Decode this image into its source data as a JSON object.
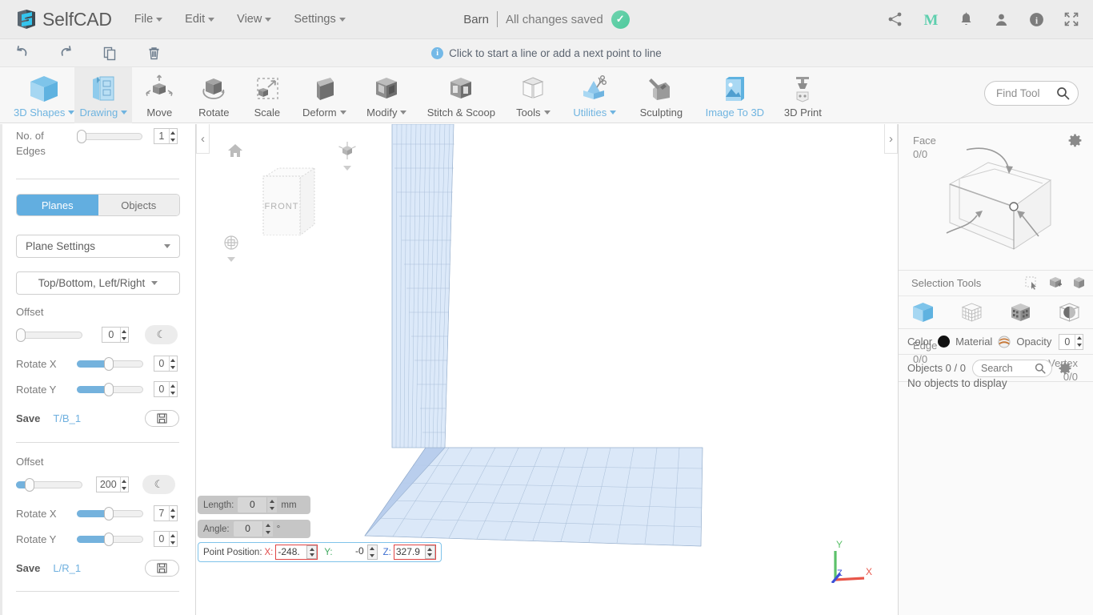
{
  "app": {
    "brand": "SelfCAD",
    "menus": [
      {
        "label": "File",
        "caret": true
      },
      {
        "label": "Edit",
        "caret": true
      },
      {
        "label": "View",
        "caret": true
      },
      {
        "label": "Settings",
        "caret": true
      }
    ],
    "document": {
      "name": "Barn",
      "status": "All changes saved",
      "status_icon": "check-circle-icon"
    },
    "top_icons": [
      "share-icon",
      "m-logo-icon",
      "bell-icon",
      "user-icon",
      "info-icon",
      "fullscreen-icon"
    ]
  },
  "actionbar": {
    "buttons": [
      "undo-icon",
      "redo-icon",
      "copy-icon",
      "trash-icon"
    ],
    "hint": "Click to start a line or add a next point to line"
  },
  "ribbon": {
    "tools": [
      {
        "label": "3D Shapes",
        "caret": true,
        "blue": true,
        "icon": "cube-blue-icon",
        "active": false
      },
      {
        "label": "Drawing",
        "caret": true,
        "blue": true,
        "icon": "drawing-icon",
        "active": true
      },
      {
        "label": "Move",
        "caret": false,
        "blue": false,
        "icon": "move-icon",
        "active": false
      },
      {
        "label": "Rotate",
        "caret": false,
        "blue": false,
        "icon": "rotate-icon",
        "active": false
      },
      {
        "label": "Scale",
        "caret": false,
        "blue": false,
        "icon": "scale-icon",
        "active": false
      },
      {
        "label": "Deform",
        "caret": true,
        "blue": false,
        "icon": "deform-icon",
        "active": false
      },
      {
        "label": "Modify",
        "caret": true,
        "blue": false,
        "icon": "modify-icon",
        "active": false
      },
      {
        "label": "Stitch & Scoop",
        "caret": false,
        "blue": false,
        "icon": "stitch-scoop-icon",
        "active": false
      },
      {
        "label": "Tools",
        "caret": true,
        "blue": false,
        "icon": "tools-icon",
        "active": false
      },
      {
        "label": "Utilities",
        "caret": true,
        "blue": true,
        "icon": "utilities-icon",
        "active": false
      },
      {
        "label": "Sculpting",
        "caret": false,
        "blue": false,
        "icon": "sculpting-icon",
        "active": false
      },
      {
        "label": "Image To 3D",
        "caret": false,
        "blue": true,
        "icon": "image-to-3d-icon",
        "active": false
      },
      {
        "label": "3D Print",
        "caret": false,
        "blue": false,
        "icon": "3d-print-icon",
        "active": false
      }
    ],
    "find_tool": {
      "placeholder": "Find Tool",
      "icon": "search-icon"
    }
  },
  "left_panel": {
    "edges": {
      "label": "No. of Edges",
      "value": "1",
      "slider_percent": 0
    },
    "mode_toggle": {
      "options": [
        "Planes",
        "Objects"
      ],
      "selected": "Planes"
    },
    "plane_settings_dropdown": {
      "value": "Plane Settings"
    },
    "plane_axis_dropdown": {
      "value": "Top/Bottom, Left/Right"
    },
    "group_tb": {
      "offset_label": "Offset",
      "offset_value": "0",
      "offset_slider_percent": 0,
      "rotate_x_label": "Rotate X",
      "rotate_x_value": "0",
      "rotate_x_slider_percent": 48,
      "rotate_y_label": "Rotate Y",
      "rotate_y_value": "0",
      "rotate_y_slider_percent": 48,
      "save_label": "Save",
      "save_name": "T/B_1",
      "reset_icon": "moon-icon",
      "save_icon": "floppy-icon"
    },
    "group_lr": {
      "offset_label": "Offset",
      "offset_value": "200",
      "offset_slider_percent": 10,
      "rotate_x_label": "Rotate X",
      "rotate_x_value": "7",
      "rotate_x_slider_percent": 48,
      "rotate_y_label": "Rotate Y",
      "rotate_y_value": "0",
      "rotate_y_slider_percent": 48,
      "save_label": "Save",
      "save_name": "L/R_1",
      "reset_icon": "moon-icon",
      "save_icon": "floppy-icon"
    }
  },
  "viewport": {
    "collapse_left_icon": "chevron-left-icon",
    "collapse_right_icon": "chevron-right-icon",
    "home_icon": "home-icon",
    "gizmo_icon": "gizmo-icon",
    "perspective_icon": "perspective-icon",
    "navcube_label": "FRONT",
    "length": {
      "label": "Length:",
      "value": "0",
      "unit": "mm"
    },
    "angle": {
      "label": "Angle:",
      "value": "0",
      "unit": "°"
    },
    "point_position": {
      "label": "Point Position:",
      "x_label": "X:",
      "x_value": "-248.",
      "y_label": "Y:",
      "y_value": "-0",
      "z_label": "Z:",
      "z_value": "327.9"
    },
    "axis_indicator": {
      "x": "X",
      "y": "Y",
      "z": "Z",
      "x_color": "#e8564a",
      "y_color": "#5cc16a",
      "z_color": "#3b4fd8"
    }
  },
  "right_panel": {
    "gear_icon": "gear-icon",
    "face": {
      "label": "Face",
      "count": "0/0"
    },
    "edge": {
      "label": "Edge",
      "count": "0/0"
    },
    "vertex": {
      "label": "Vertex",
      "count": "0/0"
    },
    "selection_tools": {
      "label": "Selection Tools",
      "icons": [
        "rect-select-icon",
        "box-add-select-icon",
        "box-select-icon"
      ]
    },
    "selection_modes": [
      "object-mode-icon",
      "wireframe-mode-icon",
      "voxel-mode-icon",
      "sphere-mode-icon"
    ],
    "material_bar": {
      "color_label": "Color",
      "color_value": "#111111",
      "material_label": "Material",
      "material_icon": "sphere-material-icon",
      "opacity_label": "Opacity",
      "opacity_value": "0"
    },
    "objects_bar": {
      "label": "Objects 0 / 0",
      "search_placeholder": "Search",
      "search_value": "",
      "search_icon": "search-icon",
      "settings_icon": "gear-icon"
    },
    "empty_message": "No objects to display"
  }
}
